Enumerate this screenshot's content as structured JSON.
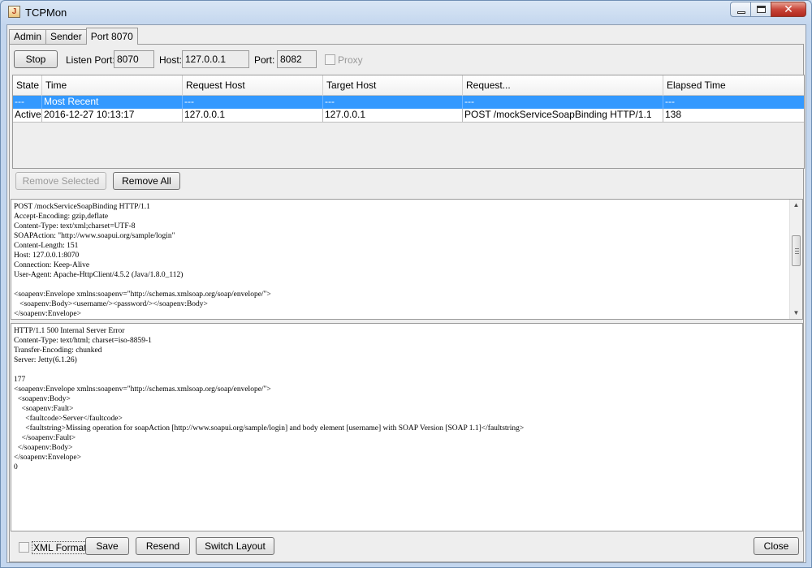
{
  "window": {
    "title": "TCPMon"
  },
  "tabs": [
    {
      "label": "Admin"
    },
    {
      "label": "Sender"
    },
    {
      "label": "Port 8070"
    }
  ],
  "listener": {
    "stop_label": "Stop",
    "listen_port_label": "Listen Port:",
    "listen_port_value": "8070",
    "host_label": "Host:",
    "host_value": "127.0.0.1",
    "port_label": "Port:",
    "port_value": "8082",
    "proxy_label": "Proxy",
    "proxy_checked": false
  },
  "table": {
    "columns": [
      "State",
      "Time",
      "Request Host",
      "Target Host",
      "Request...",
      "Elapsed Time"
    ],
    "rows": [
      {
        "state": "---",
        "time": "Most Recent",
        "request_host": "---",
        "target_host": "---",
        "request": "---",
        "elapsed": "---",
        "selected": true
      },
      {
        "state": "Active",
        "time": "2016-12-27 10:13:17",
        "request_host": "127.0.0.1",
        "target_host": "127.0.0.1",
        "request": "POST /mockServiceSoapBinding HTTP/1.1",
        "elapsed": "138",
        "selected": false
      }
    ]
  },
  "table_actions": {
    "remove_selected_label": "Remove Selected",
    "remove_all_label": "Remove All"
  },
  "request_text": "POST /mockServiceSoapBinding HTTP/1.1\nAccept-Encoding: gzip,deflate\nContent-Type: text/xml;charset=UTF-8\nSOAPAction: \"http://www.soapui.org/sample/login\"\nContent-Length: 151\nHost: 127.0.0.1:8070\nConnection: Keep-Alive\nUser-Agent: Apache-HttpClient/4.5.2 (Java/1.8.0_112)\n\n<soapenv:Envelope xmlns:soapenv=\"http://schemas.xmlsoap.org/soap/envelope/\">\n   <soapenv:Body><username/><password/></soapenv:Body>\n</soapenv:Envelope>",
  "response_text": "HTTP/1.1 500 Internal Server Error\nContent-Type: text/html; charset=iso-8859-1\nTransfer-Encoding: chunked\nServer: Jetty(6.1.26)\n\n177\n<soapenv:Envelope xmlns:soapenv=\"http://schemas.xmlsoap.org/soap/envelope/\">\n  <soapenv:Body>\n    <soapenv:Fault>\n      <faultcode>Server</faultcode>\n      <faultstring>Missing operation for soapAction [http://www.soapui.org/sample/login] and body element [username] with SOAP Version [SOAP 1.1]</faultstring>\n    </soapenv:Fault>\n  </soapenv:Body>\n</soapenv:Envelope>\n0",
  "bottom": {
    "xml_format_label": "XML Format",
    "xml_format_checked": false,
    "save_label": "Save",
    "resend_label": "Resend",
    "switch_layout_label": "Switch Layout",
    "close_label": "Close"
  },
  "colors": {
    "selection": "#3399ff",
    "window_frame": "#c3d6ee",
    "close_button": "#c9463a"
  }
}
